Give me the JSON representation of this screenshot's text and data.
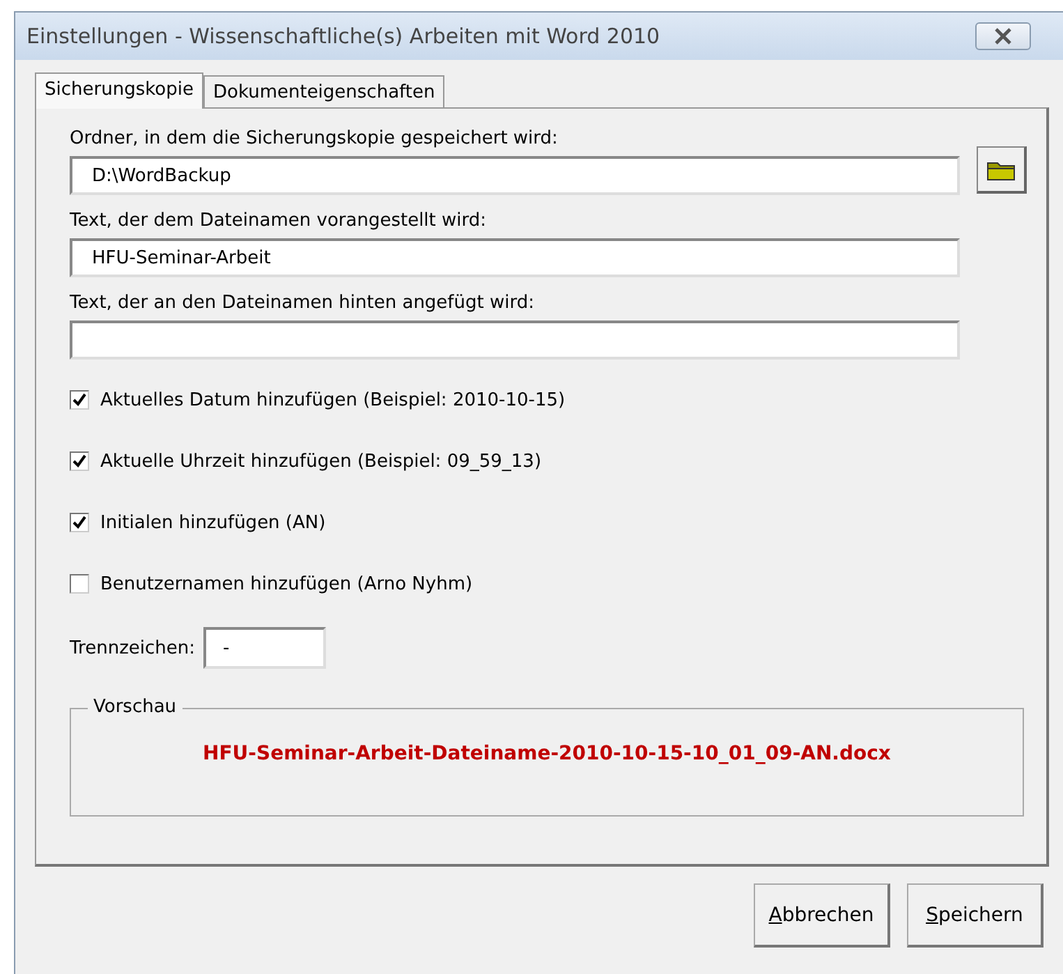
{
  "window": {
    "title": "Einstellungen - Wissenschaftliche(s) Arbeiten mit Word 2010"
  },
  "tabs": [
    {
      "label": "Sicherungskopie",
      "selected": true
    },
    {
      "label": "Dokumenteigenschaften",
      "selected": false
    }
  ],
  "folder": {
    "label": "Ordner, in dem die Sicherungskopie gespeichert wird:",
    "value": "D:\\WordBackup"
  },
  "prefix": {
    "label": "Text, der dem Dateinamen vorangestellt wird:",
    "value": "HFU-Seminar-Arbeit"
  },
  "suffix": {
    "label": "Text, der an den Dateinamen hinten angefügt wird:"
  },
  "options": [
    {
      "label": "Aktuelles Datum hinzufügen (Beispiel: 2010-10-15)",
      "checked": true
    },
    {
      "label": "Aktuelle Uhrzeit hinzufügen (Beispiel: 09_59_13)",
      "checked": true
    },
    {
      "label": "Initialen hinzufügen (AN)",
      "checked": true
    },
    {
      "label": "Benutzernamen hinzufügen (Arno Nyhm)",
      "checked": false
    }
  ],
  "separator": {
    "label": "Trennzeichen:",
    "value": "-"
  },
  "preview": {
    "legend": "Vorschau",
    "text": "HFU-Seminar-Arbeit-Dateiname-2010-10-15-10_01_09-AN.docx"
  },
  "buttons": [
    {
      "label": "Abbrechen",
      "first_letter_underlined": true
    },
    {
      "label": "Speichern",
      "first_letter_underlined": true
    }
  ]
}
